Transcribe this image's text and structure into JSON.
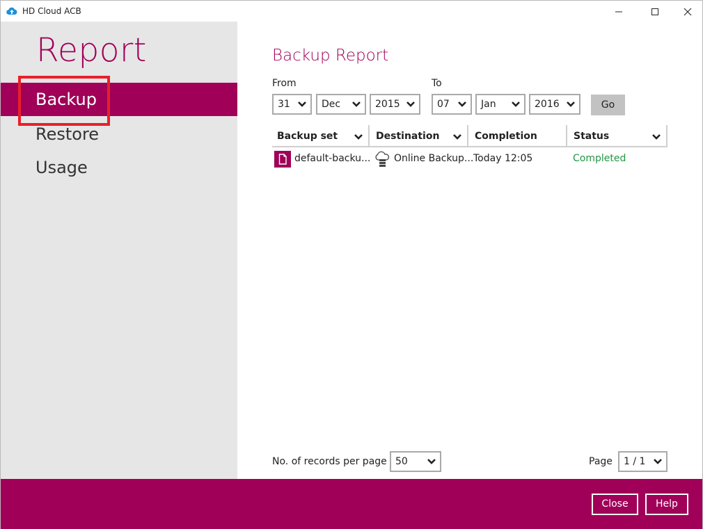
{
  "window": {
    "title": "HD Cloud ACB",
    "app_icon": "cloud-upload-icon"
  },
  "sidebar": {
    "heading": "Report",
    "items": [
      {
        "label": "Backup",
        "active": true
      },
      {
        "label": "Restore",
        "active": false
      },
      {
        "label": "Usage",
        "active": false
      }
    ]
  },
  "main": {
    "title": "Backup Report",
    "filters": {
      "from_label": "From",
      "to_label": "To",
      "from_day": "31",
      "from_month": "Dec",
      "from_year": "2015",
      "to_day": "07",
      "to_month": "Jan",
      "to_year": "2016",
      "go_label": "Go"
    },
    "table": {
      "columns": [
        "Backup set",
        "Destination",
        "Completion",
        "Status"
      ],
      "rows": [
        {
          "backup_set": "default-backu...",
          "destination": "Online Backup...",
          "completion": "Today 12:05",
          "status": "Completed",
          "set_icon": "file-icon",
          "destination_icon": "cloud-storage-icon"
        }
      ]
    },
    "footer": {
      "records_label": "No. of records per page",
      "records_value": "50",
      "page_label": "Page",
      "page_value": "1 / 1"
    }
  },
  "bottom_bar": {
    "close_label": "Close",
    "help_label": "Help"
  },
  "colors": {
    "brand": "#a00058",
    "status_completed": "#229744",
    "highlight": "#e8202a"
  }
}
